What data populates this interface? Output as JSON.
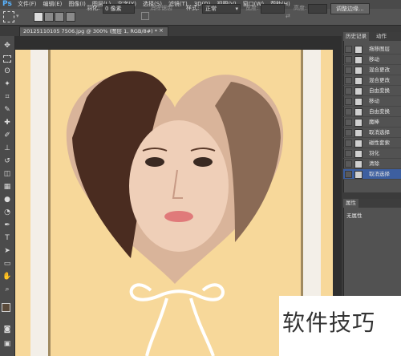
{
  "app": {
    "logo": "Ps"
  },
  "menu": [
    "文件(F)",
    "编辑(E)",
    "图像(I)",
    "图层(L)",
    "文字(Y)",
    "选择(S)",
    "滤镜(T)",
    "3D(D)",
    "视图(V)",
    "窗口(W)",
    "帮助(H)"
  ],
  "options_bar": {
    "feather_label": "羽化:",
    "feather_value": "0 像素",
    "antialias_label": "消除锯齿",
    "style_label": "样式:",
    "style_value": "正常",
    "width_label": "宽度:",
    "height_label": "高度:",
    "refine_button": "调整边缘..."
  },
  "document_tab": {
    "title": "20125110105 7506.jpg @ 300% (图层 1, RGB/8#) *",
    "close": "×"
  },
  "history_panel": {
    "tabs": [
      "历史记录",
      "动作"
    ],
    "items": [
      {
        "label": "拖移图层"
      },
      {
        "label": "移动"
      },
      {
        "label": "混合更改"
      },
      {
        "label": "混合更改"
      },
      {
        "label": "自由变换"
      },
      {
        "label": "移动"
      },
      {
        "label": "自由变换"
      },
      {
        "label": "魔棒"
      },
      {
        "label": "取消选择"
      },
      {
        "label": "磁性套索"
      },
      {
        "label": "羽化"
      },
      {
        "label": "清除"
      },
      {
        "label": "取消选择"
      }
    ],
    "selected_index": 12
  },
  "properties_panel": {
    "tab": "属性",
    "content": "无属性"
  },
  "watermark": {
    "text": "软件技巧"
  },
  "colors": {
    "canvas_bg": "#f7d89a",
    "history_selected": "#3d5fa0",
    "ps_blue": "#59b4ff"
  }
}
